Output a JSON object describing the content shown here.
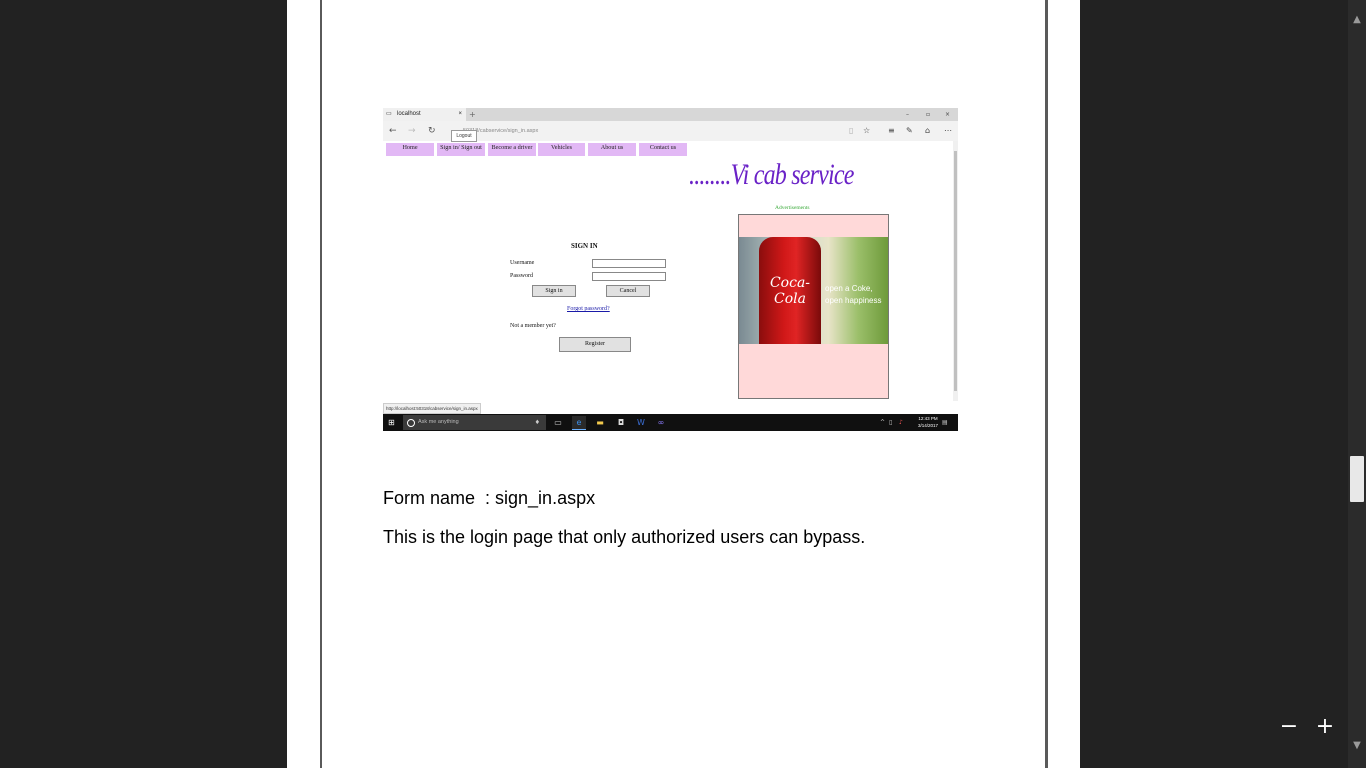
{
  "viewer": {
    "zoom_out_label": "−",
    "zoom_in_label": "+",
    "scroll_up_label": "▲",
    "scroll_down_label": "▼"
  },
  "screenshot": {
    "tab_title": "localhost",
    "tab_close": "×",
    "new_tab": "+",
    "window_controls": [
      "–",
      "▫",
      "×"
    ],
    "url": "50318/cabservice/sign_in.aspx",
    "tooltip": "Logout",
    "nav_items": [
      "Home",
      "Sign in/ Sign out",
      "Become a driver",
      "Vehicles",
      "About us",
      "Contact us"
    ],
    "brand": "........Vi cab service",
    "ads_label": "Advertisements",
    "ad": {
      "logo_text": "Coca-Cola",
      "slogan_line1": "open a Coke,",
      "slogan_line2": "open happiness"
    },
    "form": {
      "title": "SIGN IN",
      "username_label": "Username",
      "password_label": "Password",
      "signin_button": "Sign in",
      "cancel_button": "Cancel",
      "forgot_link": "Forgot password?",
      "not_member": "Not a member yet?",
      "register_button": "Register"
    },
    "status_url": "http://localhost:50318/cabservice/sign_in.aspx",
    "taskbar": {
      "search_placeholder": "Ask me anything",
      "time": "12:43 PM",
      "date": "3/14/2017"
    },
    "colors": {
      "nav_bg": "#e2b8f5",
      "brand": "#6a22c7",
      "ad_bg": "#ffd9d9",
      "ads_label": "#3aaa3a"
    }
  },
  "caption": {
    "form_name": "Form name  : sign_in.aspx",
    "description": "This is the login page that only authorized users can bypass."
  }
}
